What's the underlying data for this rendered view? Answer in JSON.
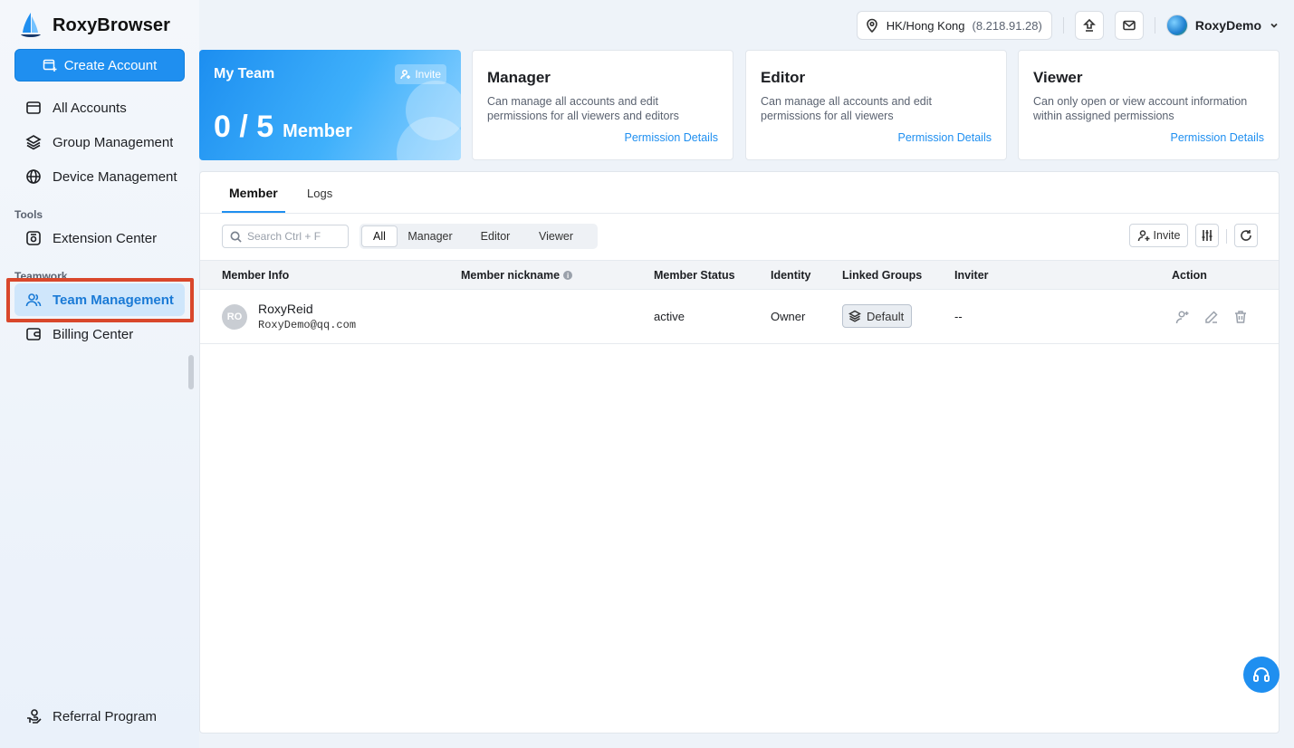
{
  "app": {
    "name": "RoxyBrowser"
  },
  "sidebar": {
    "create_label": "Create Account",
    "items": [
      {
        "label": "All Accounts",
        "icon": "folder-icon"
      },
      {
        "label": "Group Management",
        "icon": "layers-icon"
      },
      {
        "label": "Device Management",
        "icon": "globe-icon"
      }
    ],
    "tools_label": "Tools",
    "tools_items": [
      {
        "label": "Extension Center",
        "icon": "extension-icon"
      }
    ],
    "teamwork_label": "Teamwork",
    "teamwork_items": [
      {
        "label": "Team Management",
        "icon": "users-icon",
        "active": true
      },
      {
        "label": "Billing Center",
        "icon": "wallet-icon"
      }
    ],
    "referral_label": "Referral Program"
  },
  "topbar": {
    "location": "HK/Hong Kong",
    "ip": "(8.218.91.28)",
    "username": "RoxyDemo"
  },
  "team_card": {
    "title": "My Team",
    "invite_label": "Invite",
    "count": "0 / 5",
    "unit": "Member"
  },
  "roles": [
    {
      "title": "Manager",
      "desc": "Can manage all accounts and edit permissions for all viewers and editors",
      "link": "Permission Details"
    },
    {
      "title": "Editor",
      "desc": "Can manage all accounts and edit permissions for all viewers",
      "link": "Permission Details"
    },
    {
      "title": "Viewer",
      "desc": "Can only open or view account information within assigned permissions",
      "link": "Permission Details"
    }
  ],
  "tabs": {
    "member": "Member",
    "logs": "Logs"
  },
  "filters": {
    "search_placeholder": "Search Ctrl + F",
    "segments": [
      "All",
      "Manager",
      "Editor",
      "Viewer"
    ],
    "active_segment": "All",
    "invite_label": "Invite"
  },
  "table": {
    "headers": {
      "member_info": "Member Info",
      "nickname": "Member nickname",
      "status": "Member Status",
      "identity": "Identity",
      "groups": "Linked Groups",
      "inviter": "Inviter",
      "action": "Action"
    },
    "rows": [
      {
        "initials": "RO",
        "name": "RoxyReid",
        "email": "RoxyDemo@qq.com",
        "nickname": "",
        "status": "active",
        "identity": "Owner",
        "group": "Default",
        "inviter": "--"
      }
    ]
  },
  "colors": {
    "accent": "#1f8ff0",
    "highlight": "#d9472b",
    "active_nav_bg": "#cfe6fb"
  }
}
